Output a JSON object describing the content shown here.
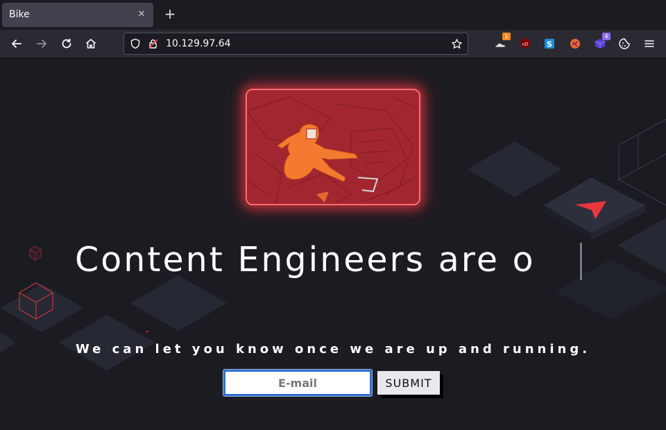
{
  "browser": {
    "tab_title": "Bike",
    "tab_close": "✕",
    "new_tab": "+",
    "url": "10.129.97.64",
    "extensions": [
      {
        "name": "shoe-icon",
        "badge": "1",
        "badge_color": "#f28a22"
      },
      {
        "name": "ublock-icon",
        "badge": "",
        "badge_color": ""
      },
      {
        "name": "s-extension-icon",
        "badge": "",
        "badge_color": ""
      },
      {
        "name": "firefox-relay-icon",
        "badge": "",
        "badge_color": ""
      },
      {
        "name": "cube-extension-icon",
        "badge": "4",
        "badge_color": "#8a6cf0"
      },
      {
        "name": "cookie-icon",
        "badge": "",
        "badge_color": ""
      }
    ]
  },
  "page": {
    "headline": "Content Engineers are o",
    "subline": "We can let you know once we are up and running.",
    "email_placeholder": "E-mail",
    "submit_label": "SUBMIT"
  },
  "colors": {
    "page_bg": "#1b1c22",
    "accent_red": "#e8363f",
    "hero_red": "#a1262f",
    "tile": "#2a2c36"
  }
}
